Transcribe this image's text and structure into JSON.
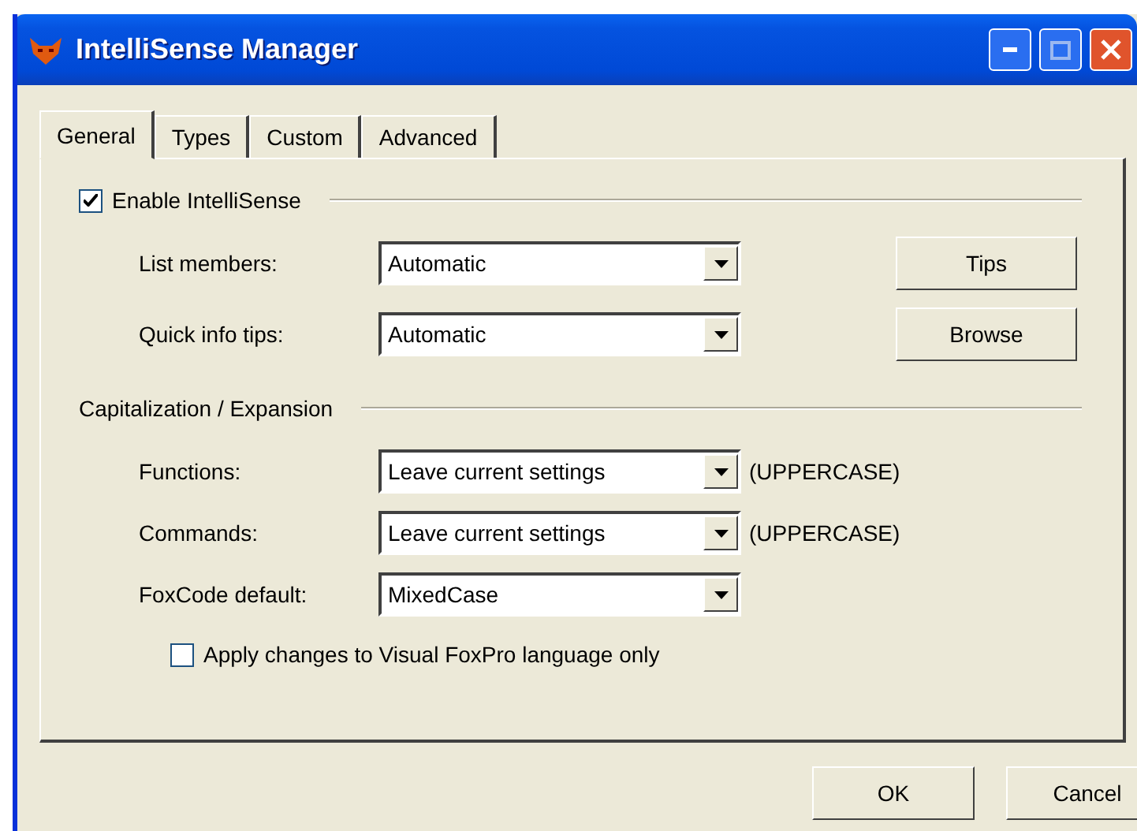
{
  "window": {
    "title": "IntelliSense Manager"
  },
  "tabs": [
    {
      "label": "General",
      "selected": true
    },
    {
      "label": "Types",
      "selected": false
    },
    {
      "label": "Custom",
      "selected": false
    },
    {
      "label": "Advanced",
      "selected": false
    }
  ],
  "enable_intellisense": {
    "label": "Enable IntelliSense",
    "checked": true
  },
  "tips_settings": [
    {
      "label": "List members:",
      "value": "Automatic"
    },
    {
      "label": "Quick info tips:",
      "value": "Automatic"
    }
  ],
  "side_buttons": [
    "Tips",
    "Browse"
  ],
  "capitalization": {
    "title": "Capitalization / Expansion",
    "rows": [
      {
        "label": "Functions:",
        "value": "Leave current settings",
        "note": "(UPPERCASE)"
      },
      {
        "label": "Commands:",
        "value": "Leave current settings",
        "note": "(UPPERCASE)"
      },
      {
        "label": "FoxCode default:",
        "value": "MixedCase"
      }
    ]
  },
  "apply_vfp_only": {
    "label": "Apply changes to Visual FoxPro language only",
    "checked": false
  },
  "dialog_buttons": [
    "OK",
    "Cancel"
  ]
}
